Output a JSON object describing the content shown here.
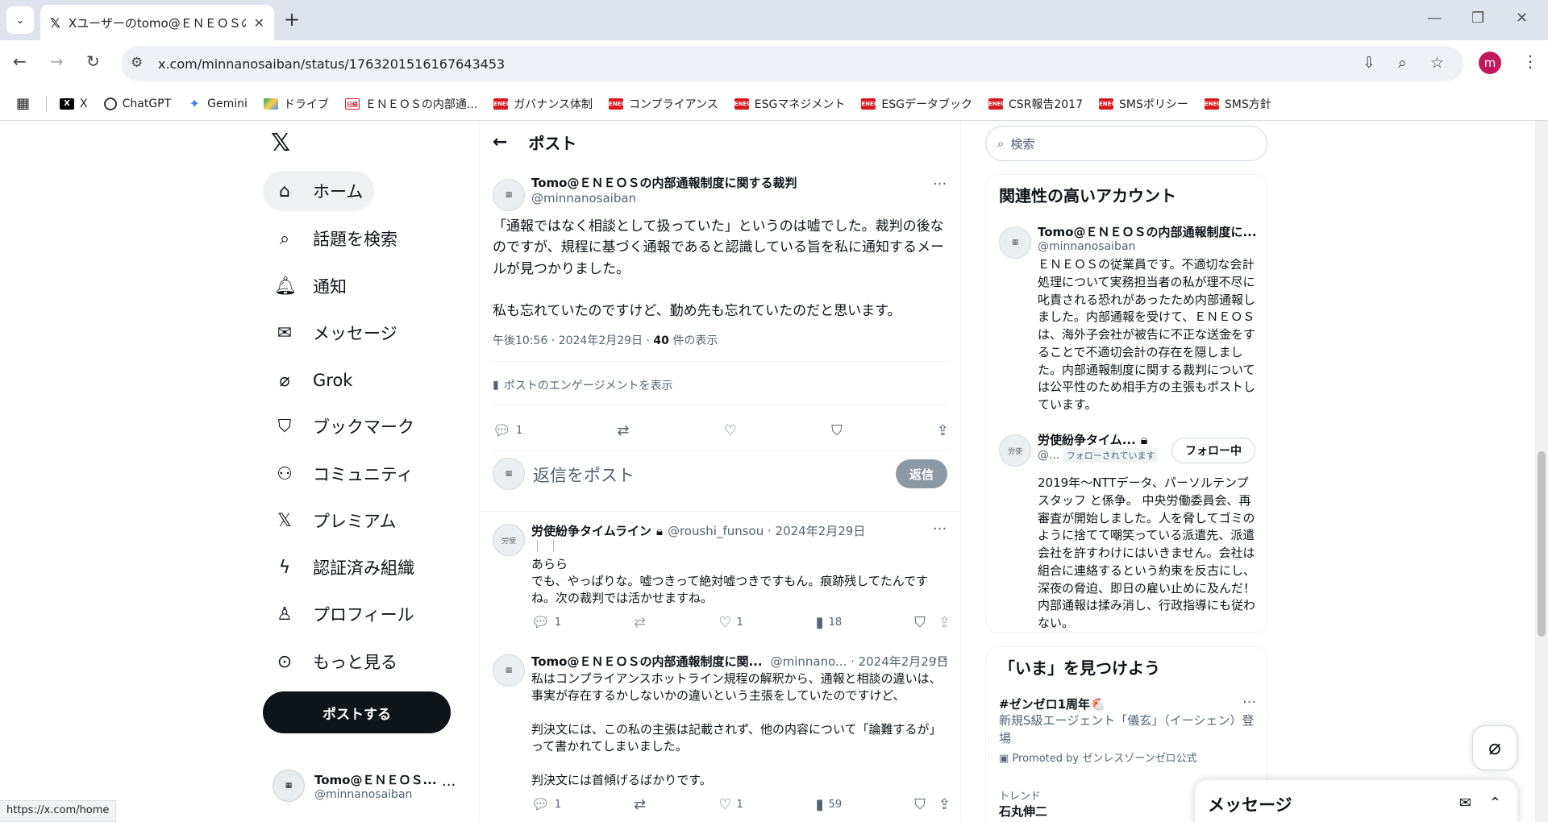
{
  "browser": {
    "tab_title": "Xユーザーのtomo@ＥＮＥＯＳの内部通報制度に関する裁判",
    "url": "x.com/minnanosaiban/status/1763201516167643453",
    "status_url": "https://x.com/home",
    "profile_initial": "m",
    "bookmarks": [
      "X",
      "ChatGPT",
      "Gemini",
      "ドライブ",
      "ＥＮＥＯＳの内部通...",
      "ガバナンス体制",
      "コンプライアンス",
      "ESGマネジメント",
      "ESGデータブック",
      "CSR報告2017",
      "SMSポリシー",
      "SMS方針"
    ]
  },
  "nav": {
    "items": [
      "ホーム",
      "話題を検索",
      "通知",
      "メッセージ",
      "Grok",
      "ブックマーク",
      "コミュニティ",
      "プレミアム",
      "認証済み組織",
      "プロフィール",
      "もっと見る"
    ],
    "post_button": "ポストする",
    "account_name": "Tomo@ＥＮＥＯＳ...",
    "account_handle": "@minnanosaiban"
  },
  "main": {
    "header_title": "ポスト",
    "post": {
      "name": "Tomo@ＥＮＥＯＳの内部通報制度に関する裁判",
      "handle": "@minnanosaiban",
      "text1": "「通報ではなく相談として扱っていた」というのは嘘でした。裁判の後なのですが、規程に基づく通報であると認識している旨を私に通知するメールが見つかりました。",
      "text2": "私も忘れていたのですけど、勤め先も忘れていたのだと思います。",
      "time": "午後10:56 · 2024年2月29日 · ",
      "views_count": "40",
      "views_label": " 件の表示",
      "engagement": "ポストのエンゲージメントを表示",
      "reply_count": "1"
    },
    "reply_box": {
      "placeholder": "返信をポスト",
      "button": "返信"
    },
    "replies": [
      {
        "name": "労使紛争タイムライン",
        "handle": "@roushi_funsou · 2024年2月29日",
        "line0": "｜ ｜",
        "text": "あらら\nでも、やっぱりな。嘘つきって絶対嘘つきですもん。痕跡残してたんですね。次の裁判では活かせますね。",
        "replies": "1",
        "likes": "1",
        "views": "18"
      },
      {
        "name": "Tomo@ＥＮＥＯＳの内部通報制度に関...",
        "handle": "@minnano... · 2024年2月29日",
        "text": "私はコンプライアンスホットライン規程の解釈から、通報と相談の違いは、事実が存在するかしないかの違いという主張をしていたのですけど、\n\n判決文には、この私の主張は記載されず、他の内容について「論難するが」って書かれてしまいました。\n\n判決文には首傾げるばかりです。",
        "replies": "1",
        "likes": "1",
        "views": "59"
      }
    ]
  },
  "sidebar": {
    "search_placeholder": "検索",
    "related_title": "関連性の高いアカウント",
    "acc1": {
      "name": "Tomo@ＥＮＥＯＳの内部通報制度に...",
      "handle": "@minnanosaiban",
      "bio": "ＥＮＥＯＳの従業員です。不適切な会計処理について実務担当者の私が理不尽に叱責される恐れがあったため内部通報しました。内部通報を受けて、ＥＮＥＯＳは、海外子会社が被告に不正な送金をすることで不適切会計の存在を隠しました。内部通報制度に関する裁判については公平性のため相手方の主張もポストしています。"
    },
    "acc2": {
      "name": "労使紛争タイム...",
      "handle": "@...",
      "follows_you": "フォローされています",
      "follow_button": "フォロー中",
      "bio": "2019年〜NTTデータ、パーソルテンプスタッフ と係争。 中央労働委員会、再審査が開始しました。人を脅してゴミのように捨てて嘲笑っている派遣先、派遣会社を許すわけにはいきません。会社は組合に連絡するという約束を反古にし、深夜の脅迫、即日の雇い止めに及んだ！内部通報は揉み消し、行政指導にも従わない。"
    },
    "trends_title": "「いま」を見つけよう",
    "trend1_name": "#ゼンゼロ1周年🐔",
    "trend1_desc": "新規S級エージェント「儀玄」（イーシェン）登場",
    "trend1_promoted": "Promoted by ゼンレスゾーンゼロ公式",
    "trend2_label": "トレンド",
    "trend2_name": "石丸伸二"
  },
  "messages_drawer": {
    "title": "メッセージ"
  }
}
